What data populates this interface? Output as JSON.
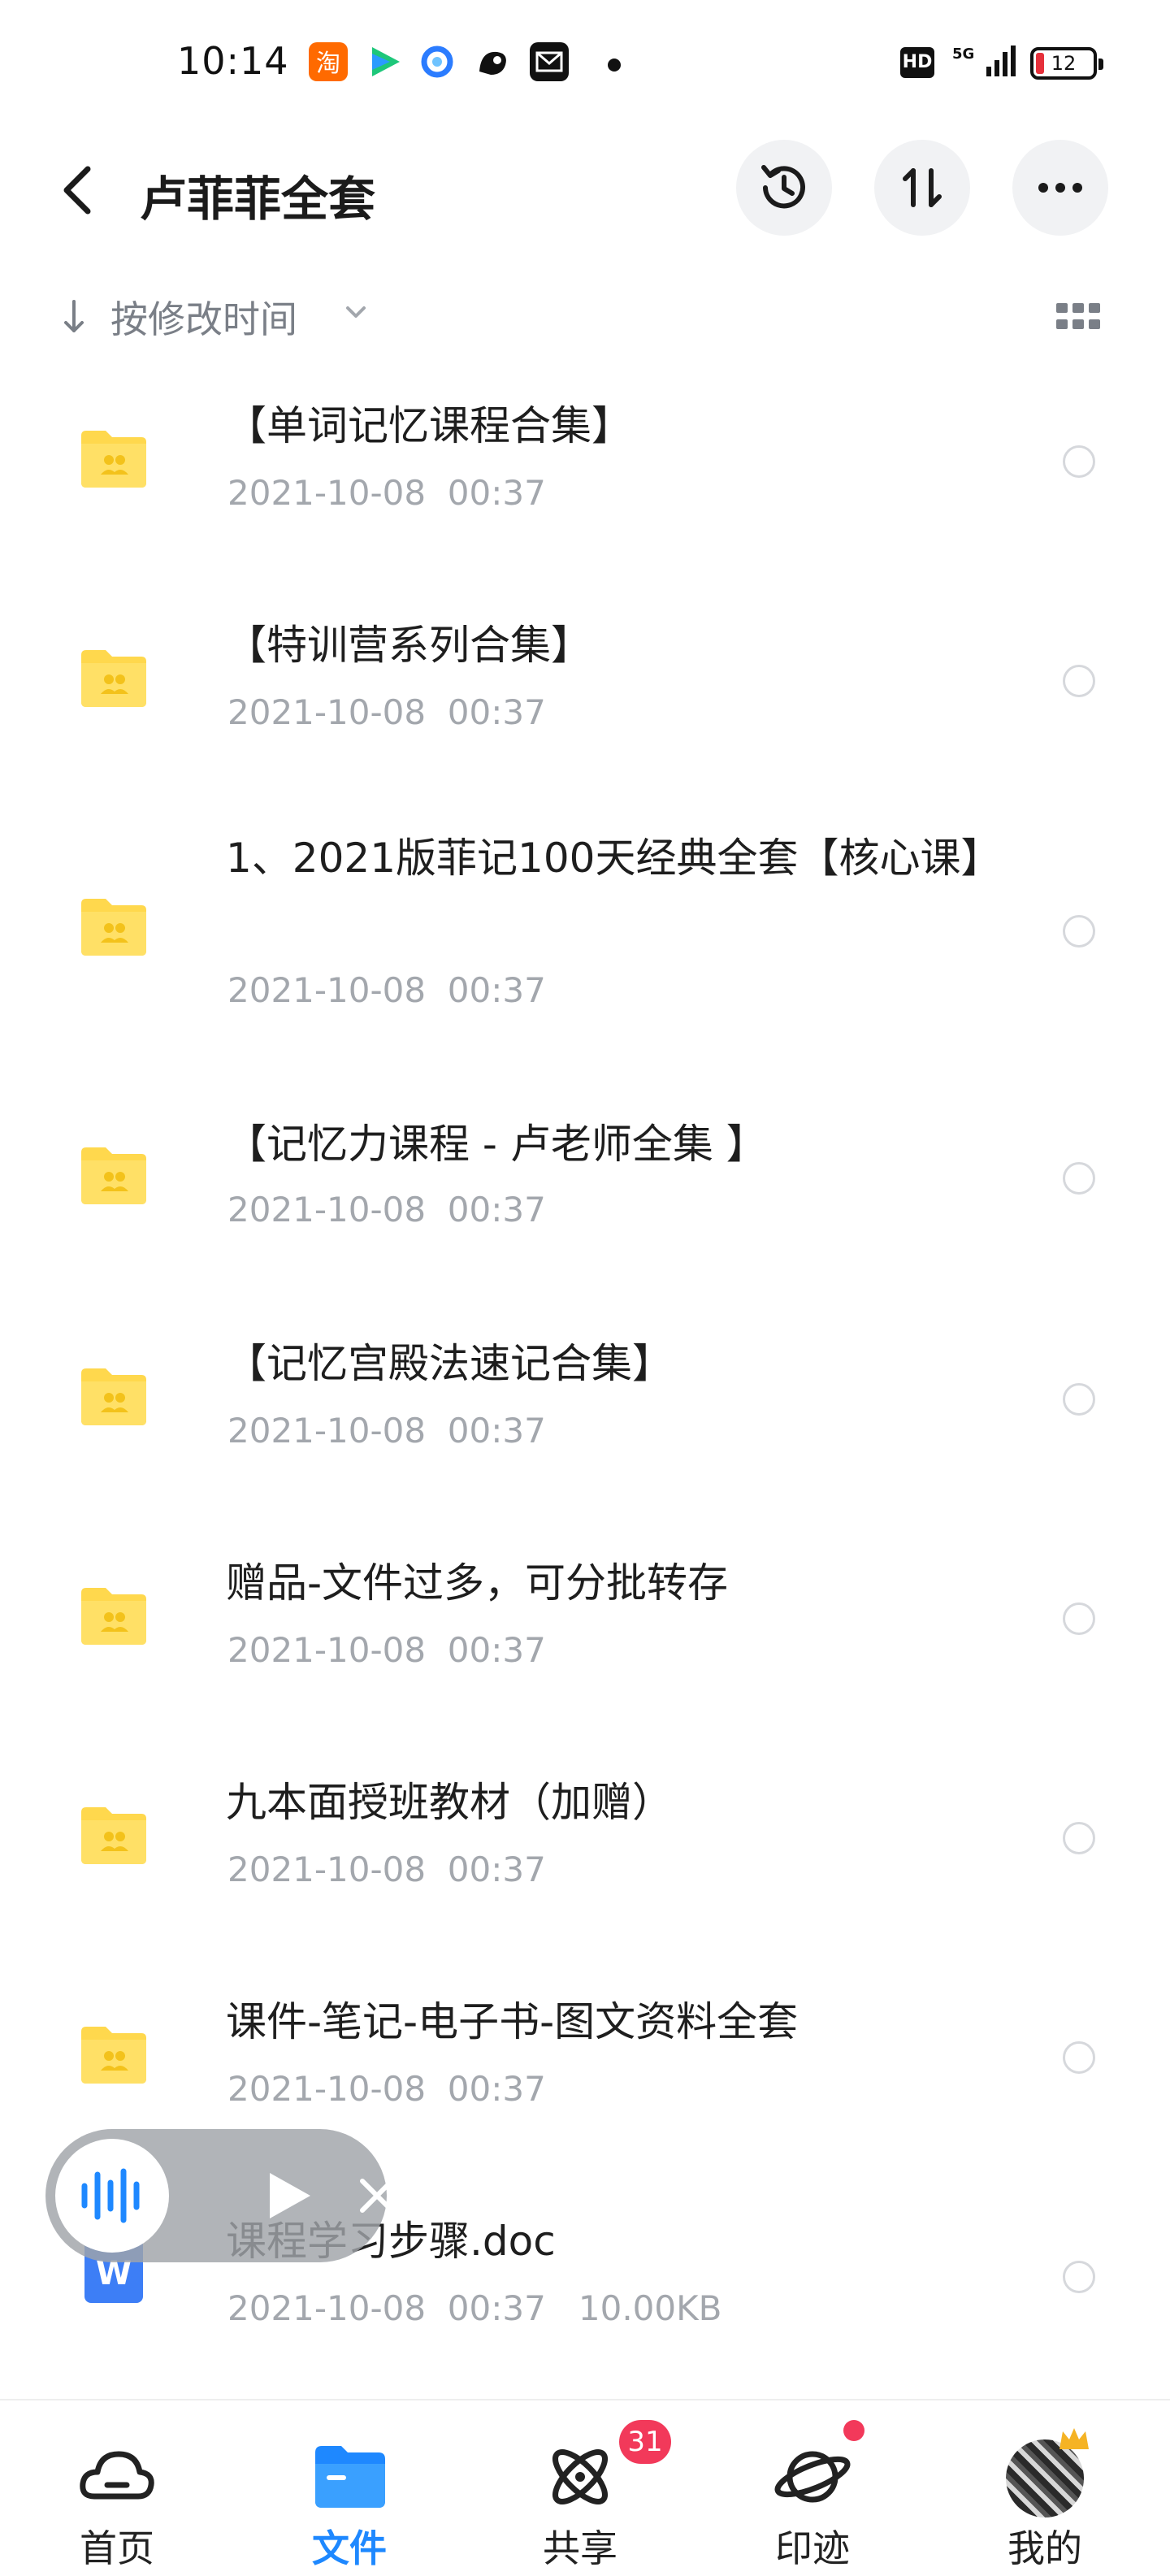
{
  "status_bar": {
    "time": "10:14",
    "network": "5G",
    "hd": "HD",
    "battery": "12",
    "app_icons": [
      "taobao-icon",
      "tencent-video-icon",
      "browser-icon",
      "uc-browser-icon",
      "mail-icon"
    ]
  },
  "header": {
    "title": "卢菲菲全套",
    "actions": [
      "history-icon",
      "sort-transfer-icon",
      "more-icon"
    ]
  },
  "sort": {
    "label": "按修改时间"
  },
  "files": [
    {
      "name": "【单词记忆课程合集】",
      "date": "2021-10-08  00:37",
      "type": "folder"
    },
    {
      "name": "【特训营系列合集】",
      "date": "2021-10-08  00:37",
      "type": "folder"
    },
    {
      "name": "1、2021版菲记100天经典全套【核心课】",
      "date": "2021-10-08  00:37",
      "type": "folder"
    },
    {
      "name": "【记忆力课程 - 卢老师全集 】",
      "date": "2021-10-08  00:37",
      "type": "folder"
    },
    {
      "name": "【记忆宫殿法速记合集】",
      "date": "2021-10-08  00:37",
      "type": "folder"
    },
    {
      "name": "赠品-文件过多，可分批转存",
      "date": "2021-10-08  00:37",
      "type": "folder"
    },
    {
      "name": "九本面授班教材（加赠）",
      "date": "2021-10-08  00:37",
      "type": "folder"
    },
    {
      "name": "课件-笔记-电子书-图文资料全套",
      "date": "2021-10-08  00:37",
      "type": "folder"
    },
    {
      "name": "课程学习步骤.doc",
      "date": "2021-10-08  00:37",
      "size": "10.00KB",
      "type": "doc",
      "icon_letter": "W"
    }
  ],
  "bottom_nav": [
    {
      "label": "首页",
      "icon": "cloud-icon",
      "active": false
    },
    {
      "label": "文件",
      "icon": "folder-icon",
      "active": true
    },
    {
      "label": "共享",
      "icon": "atom-icon",
      "active": false,
      "badge": "31"
    },
    {
      "label": "印迹",
      "icon": "planet-icon",
      "active": false
    },
    {
      "label": "我的",
      "icon": "avatar",
      "active": false
    }
  ],
  "colors": {
    "accent": "#1e88ff",
    "folder": "#ffd84d",
    "badge": "#f2395a",
    "meta_text": "#a3a7ad"
  }
}
